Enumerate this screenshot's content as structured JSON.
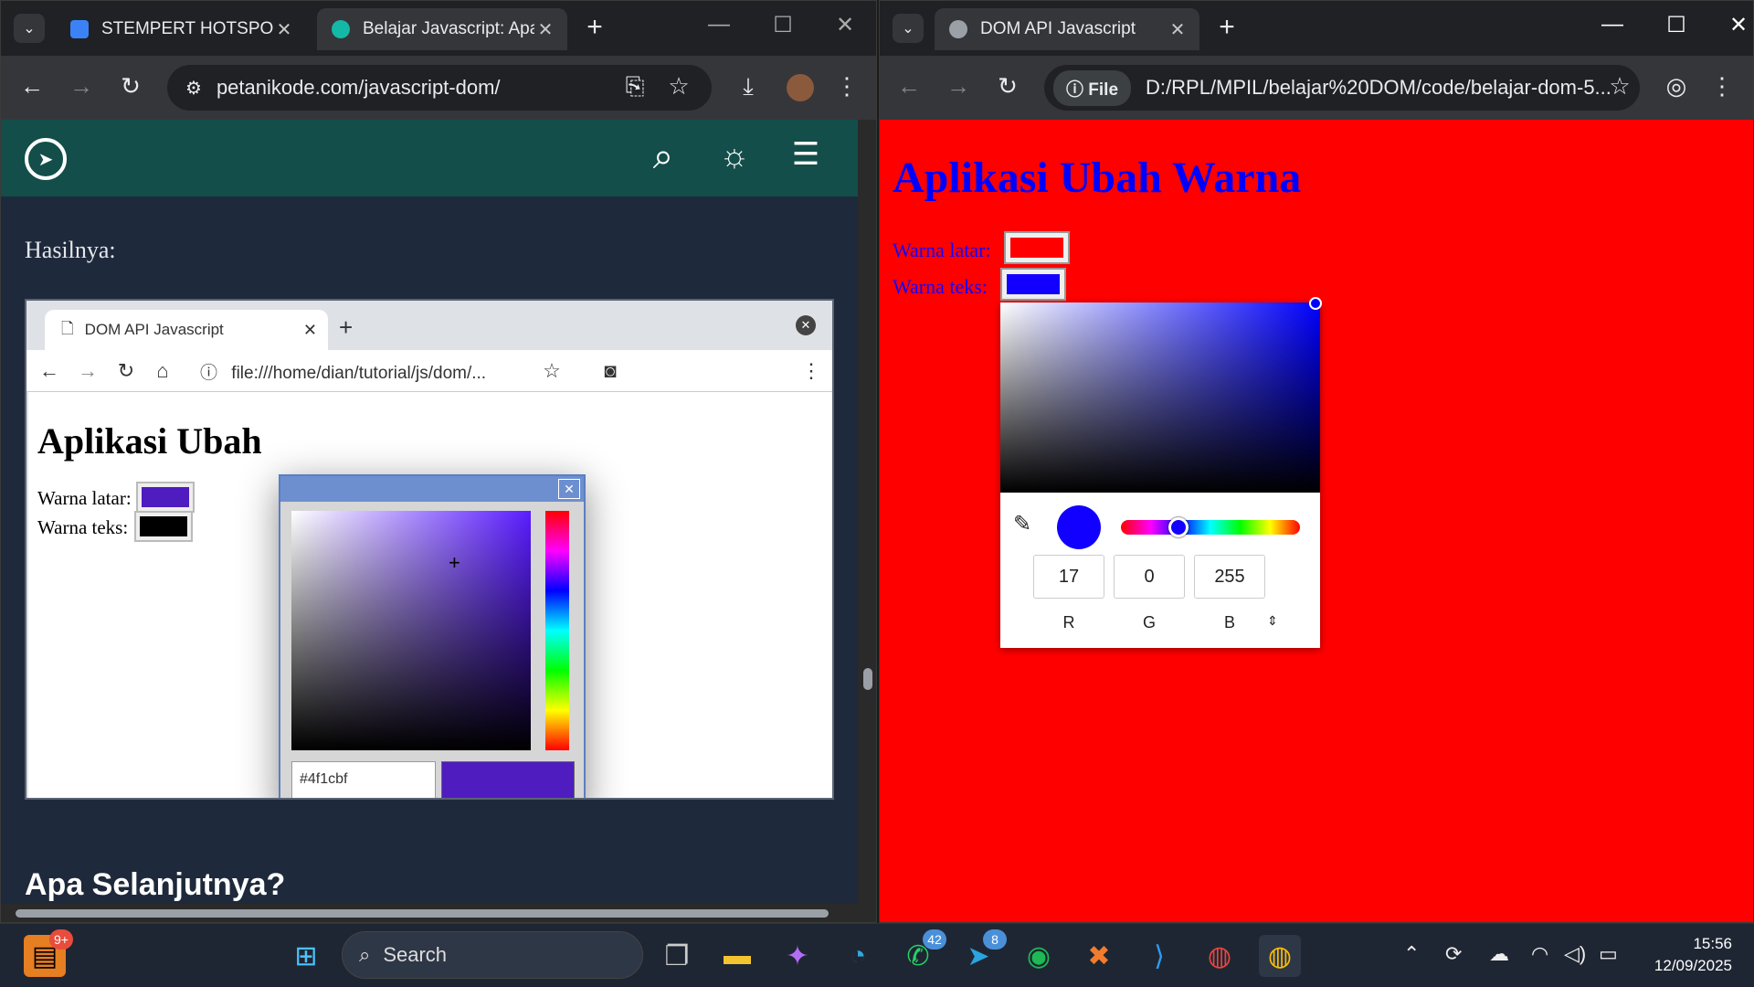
{
  "left_window": {
    "tabs": [
      {
        "title": "STEMPERT HOTSPOT"
      },
      {
        "title": "Belajar Javascript: Apa"
      }
    ],
    "url": "petanikode.com/javascript-dom/",
    "page": {
      "result_label": "Hasilnya:",
      "next_heading": "Apa Selanjutnya?",
      "screenshot": {
        "tab_title": "DOM API Javascript",
        "url": "file:///home/dian/tutorial/js/dom/...",
        "heading": "Aplikasi Ubah",
        "bg_label": "Warna latar:",
        "text_label": "Warna teks:",
        "bg_color": "#4f1cbf",
        "text_color": "#000000",
        "picker_hex": "#4f1cbf"
      }
    }
  },
  "right_window": {
    "tab_title": "DOM API Javascript",
    "url_chip": "File",
    "url": "D:/RPL/MPIL/belajar%20DOM/code/belajar-dom-5...",
    "page": {
      "heading": "Aplikasi Ubah Warna",
      "bg_label": "Warna latar:",
      "text_label": "Warna teks:",
      "bg_color": "#ff0000",
      "text_color": "#1100ff",
      "picker": {
        "r": "17",
        "g": "0",
        "b": "255",
        "r_label": "R",
        "g_label": "G",
        "b_label": "B"
      }
    }
  },
  "taskbar": {
    "search_label": "Search",
    "badge_left": "9+",
    "whatsapp_badge": "42",
    "telegram_badge": "8",
    "time": "15:56",
    "date": "12/09/2025"
  }
}
